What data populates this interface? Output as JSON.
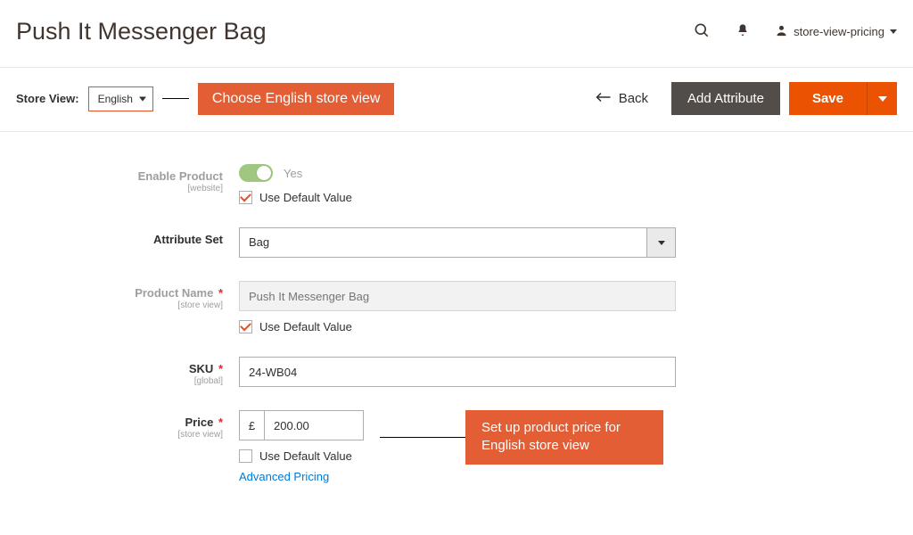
{
  "header": {
    "title": "Push It Messenger Bag",
    "user_label": "store-view-pricing"
  },
  "toolbar": {
    "store_view_label": "Store View:",
    "store_view_value": "English",
    "callout_store": "Choose English store view",
    "back_label": "Back",
    "add_attribute_label": "Add Attribute",
    "save_label": "Save"
  },
  "form": {
    "enable": {
      "label": "Enable Product",
      "scope": "[website]",
      "value_label": "Yes",
      "use_default_label": "Use Default Value",
      "use_default_checked": true
    },
    "attribute_set": {
      "label": "Attribute Set",
      "value": "Bag"
    },
    "product_name": {
      "label": "Product Name",
      "scope": "[store view]",
      "placeholder": "Push It Messenger Bag",
      "use_default_label": "Use Default Value",
      "use_default_checked": true
    },
    "sku": {
      "label": "SKU",
      "scope": "[global]",
      "value": "24-WB04"
    },
    "price": {
      "label": "Price",
      "scope": "[store view]",
      "currency": "£",
      "value": "200.00",
      "use_default_label": "Use Default Value",
      "use_default_checked": false,
      "advanced_link": "Advanced Pricing",
      "callout": "Set up product price for English store view"
    }
  }
}
